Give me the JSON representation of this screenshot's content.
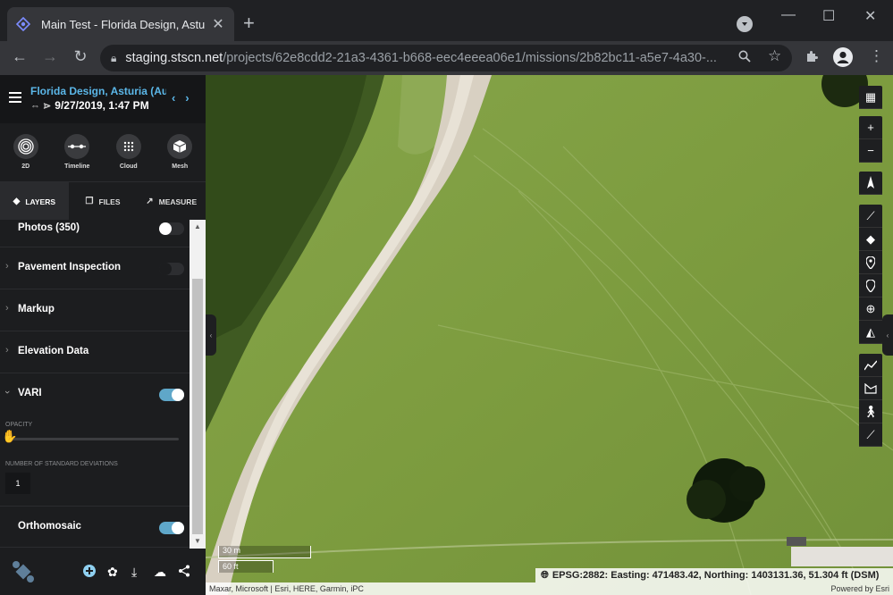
{
  "browser": {
    "tab_title": "Main Test - Florida Design, Asturi",
    "url_host": "staging.stscn.net",
    "url_path": "/projects/62e8cdd2-21a3-4361-b668-eec4eeea06e1/missions/2b82bc11-a5e7-4a30-..."
  },
  "sidebar": {
    "project_title": "Florida Design, Asturia (Au...",
    "date": "9/27/2019, 1:47 PM",
    "views": [
      {
        "label": "2D"
      },
      {
        "label": "Timeline"
      },
      {
        "label": "Cloud"
      },
      {
        "label": "Mesh"
      }
    ],
    "tabs": [
      {
        "label": "LAYERS"
      },
      {
        "label": "FILES"
      },
      {
        "label": "MEASURE"
      }
    ],
    "layers": {
      "photos": "Photos (350)",
      "pavement": "Pavement Inspection",
      "markup": "Markup",
      "elevation": "Elevation Data",
      "vari": "VARI",
      "opacity_label": "OPACITY",
      "std_label": "NUMBER OF STANDARD DEVIATIONS",
      "std_value": "1",
      "ortho": "Orthomosaic"
    }
  },
  "map": {
    "scale_metric": "30 m",
    "scale_imperial": "60 ft",
    "coordinates": "EPSG:2882: Easting: 471483.42, Northing: 1403131.36, 51.304 ft (DSM)",
    "attribution": "Maxar, Microsoft | Esri, HERE, Garmin, iPC",
    "powered_by": "Powered by Esri"
  }
}
